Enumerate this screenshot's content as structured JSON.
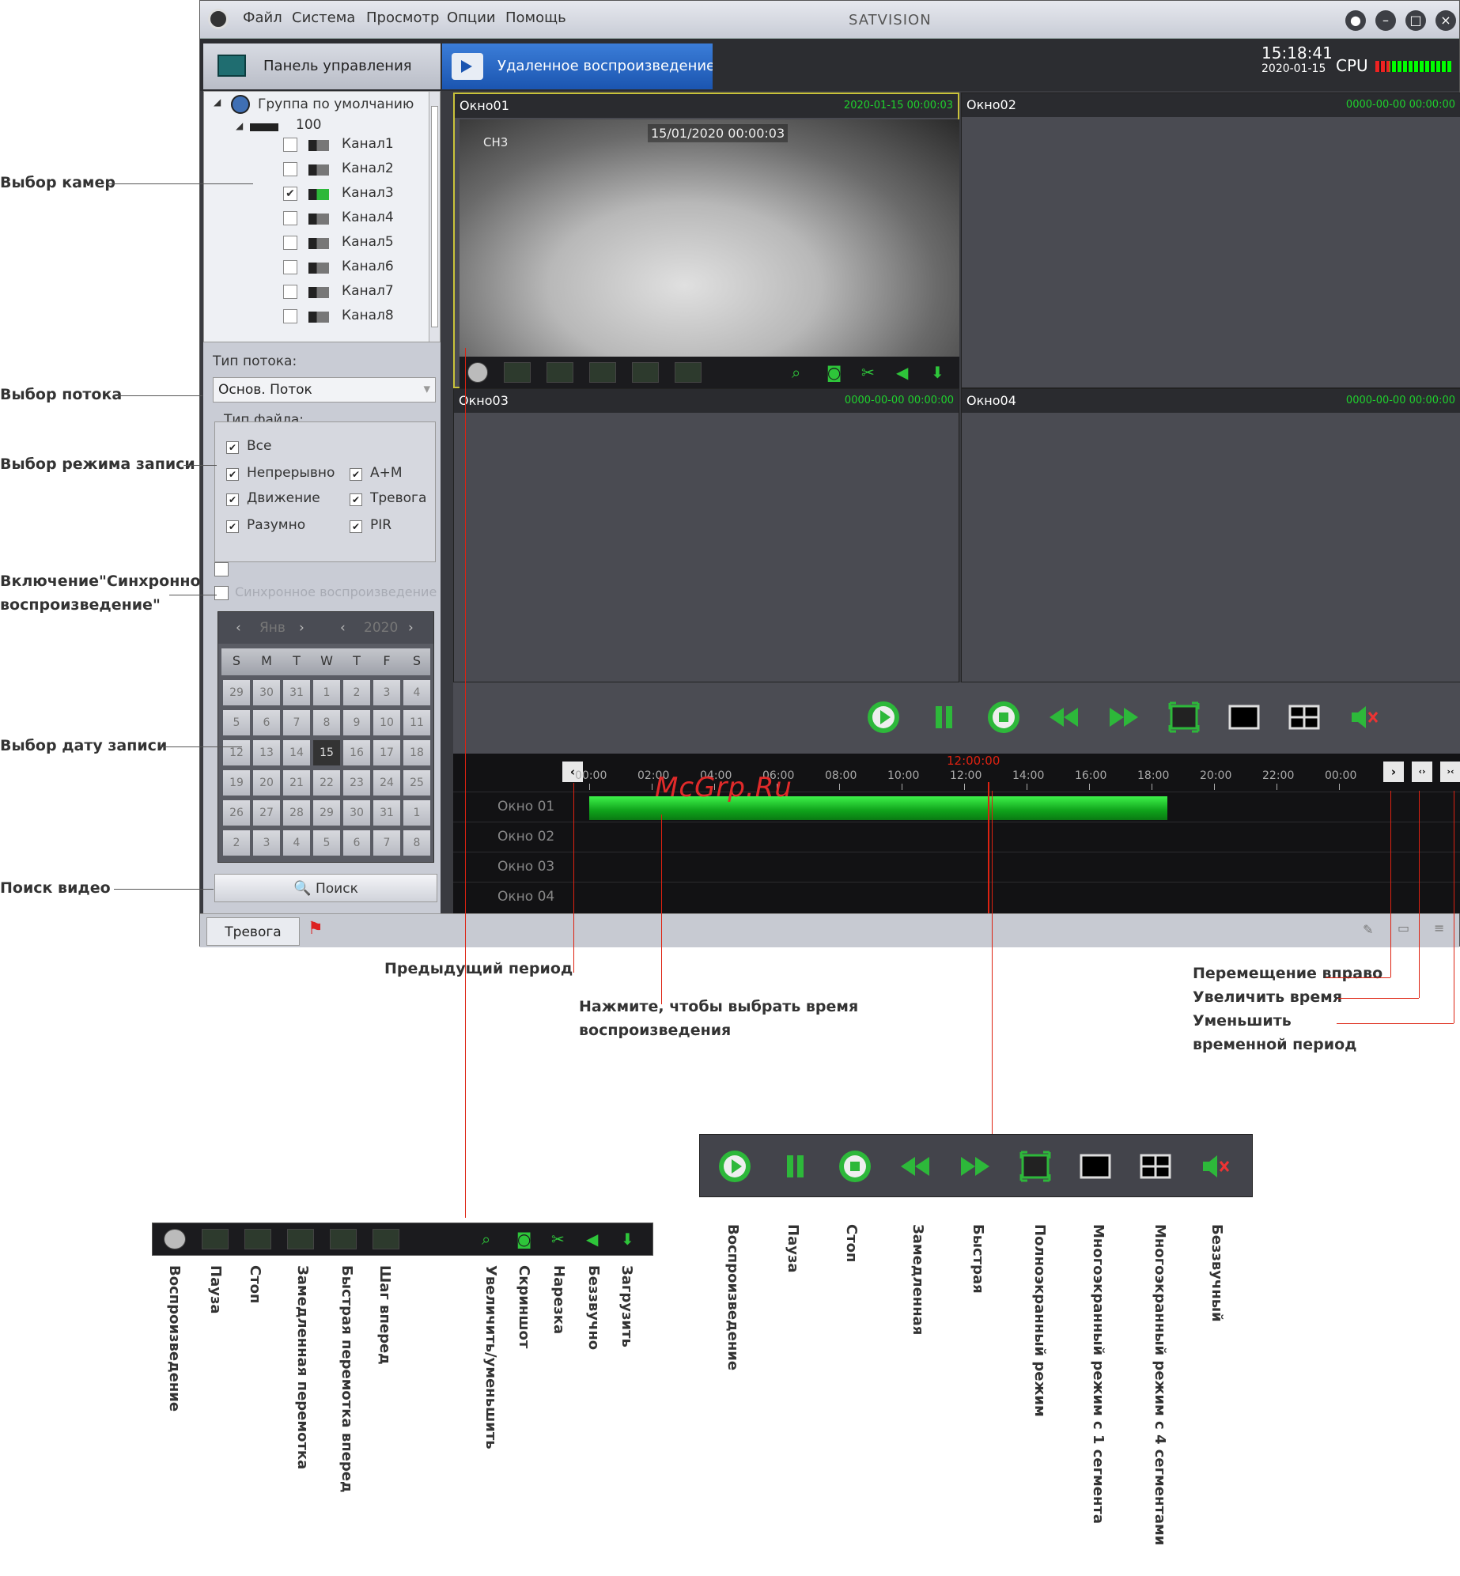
{
  "titlebar": {
    "menu": [
      "Файл",
      "Система",
      "Просмотр",
      "Опции",
      "Помощь"
    ],
    "app_title": "SATVISION"
  },
  "tabs": {
    "control_panel": "Панель управления",
    "remote_playback": "Удаленное воспроизведение"
  },
  "status": {
    "time": "15:18:41",
    "date": "2020-01-15",
    "cpu_label": "CPU"
  },
  "tree": {
    "group": "Группа по умолчанию",
    "device": "100",
    "channels": [
      {
        "label": "Канал1",
        "checked": ""
      },
      {
        "label": "Канал2",
        "checked": ""
      },
      {
        "label": "Канал3",
        "checked": "✔"
      },
      {
        "label": "Канал4",
        "checked": ""
      },
      {
        "label": "Канал5",
        "checked": ""
      },
      {
        "label": "Канал6",
        "checked": ""
      },
      {
        "label": "Канал7",
        "checked": ""
      },
      {
        "label": "Канал8",
        "checked": ""
      }
    ]
  },
  "stream": {
    "label": "Тип потока:",
    "value": "Основ. Поток"
  },
  "file_type": {
    "label": "Тип файла:",
    "options": [
      "Все",
      "Непрерывно",
      "A+M",
      "Движение",
      "Тревога",
      "Разумно",
      "PIR"
    ]
  },
  "sync": {
    "hidden_label": "",
    "label": "Синхронное воспроизведение"
  },
  "calendar": {
    "month": "Янв",
    "year": "2020",
    "dow": [
      "S",
      "M",
      "T",
      "W",
      "T",
      "F",
      "S"
    ],
    "weeks": [
      [
        "29",
        "30",
        "31",
        "1",
        "2",
        "3",
        "4"
      ],
      [
        "5",
        "6",
        "7",
        "8",
        "9",
        "10",
        "11"
      ],
      [
        "12",
        "13",
        "14",
        "15",
        "16",
        "17",
        "18"
      ],
      [
        "19",
        "20",
        "21",
        "22",
        "23",
        "24",
        "25"
      ],
      [
        "26",
        "27",
        "28",
        "29",
        "30",
        "31",
        "1"
      ],
      [
        "2",
        "3",
        "4",
        "5",
        "6",
        "7",
        "8"
      ]
    ],
    "selected": "15"
  },
  "search_button": "Поиск",
  "windows": [
    {
      "title": "Окно01",
      "time": "2020-01-15 00:00:03"
    },
    {
      "title": "Окно02",
      "time": "0000-00-00 00:00:00"
    },
    {
      "title": "Окно03",
      "time": "0000-00-00 00:00:00"
    },
    {
      "title": "Окно04",
      "time": "0000-00-00 00:00:00"
    }
  ],
  "video_overlay": {
    "timestamp": "15/01/2020 00:00:03",
    "channel": "CH3"
  },
  "timeline": {
    "cursor": "12:00:00",
    "ticks": [
      "00:00",
      "02:00",
      "04:00",
      "06:00",
      "08:00",
      "10:00",
      "12:00",
      "14:00",
      "16:00",
      "18:00",
      "20:00",
      "22:00",
      "00:00"
    ],
    "rows": [
      "Окно 01",
      "Окно 02",
      "Окно 03",
      "Окно 04"
    ],
    "record_start_hour": 0,
    "record_end_hour": 18.5
  },
  "statusbar": {
    "alarm_tab": "Тревога"
  },
  "watermark": "McGrp.Ru",
  "annotations": {
    "left": [
      "Выбор камер",
      "Выбор потока",
      "Выбор режима записи",
      "Включение\"Синхронно",
      "воспроизведение\"",
      "Выбор дату записи",
      "Поиск видео"
    ],
    "prev_period": "Предыдущий период",
    "click_time": [
      "Нажмите, чтобы выбрать время",
      "воспроизведения"
    ],
    "right": [
      "Перемещение вправо",
      "Увеличить время",
      "Уменьшить",
      "временной период"
    ]
  },
  "strip1_labels": [
    "Воспроизведение",
    "Пауза",
    "Стоп",
    "Замедленная перемотка",
    "Быстрая перемотка вперед",
    "Шаг вперед",
    "Увеличить/уменьшить",
    "Скриншот",
    "Нарезка",
    "Беззвучно",
    "Загрузить"
  ],
  "strip2_labels": [
    "Воспроизведение",
    "Пауза",
    "Стоп",
    "Замедленная",
    "Быстрая",
    "Полноэкранный режим",
    "Многоэкранный режим с 1 сегмента",
    "Многоэкранный режим с 4 сегментами",
    "Беззвучный"
  ],
  "colors": {
    "accent_green": "#1fd12d",
    "record_bar": "#12c21e",
    "annotation_red": "#d21"
  }
}
